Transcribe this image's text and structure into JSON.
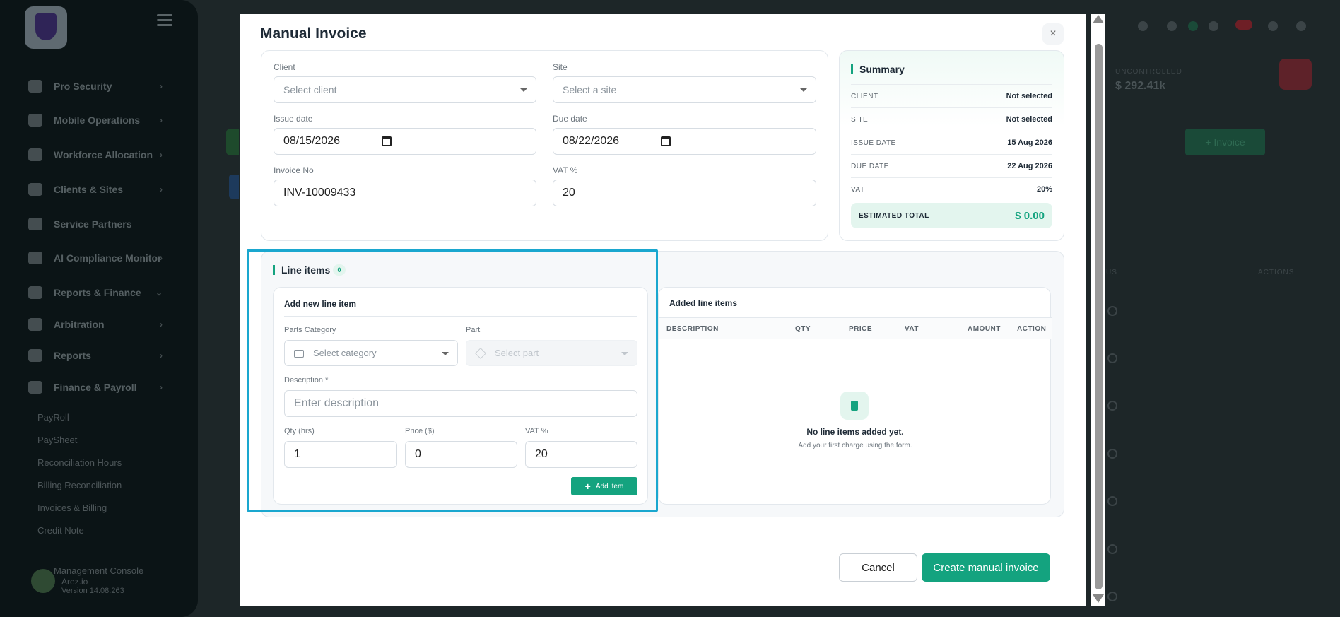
{
  "sidebar": {
    "items": [
      {
        "label": "Pro Security"
      },
      {
        "label": "Mobile Operations"
      },
      {
        "label": "Workforce Allocation"
      },
      {
        "label": "Clients & Sites"
      },
      {
        "label": "Service Partners"
      },
      {
        "label": "AI Compliance Monitor"
      },
      {
        "label": "Reports & Finance"
      },
      {
        "label": "Arbitration"
      },
      {
        "label": "Reports"
      },
      {
        "label": "Finance & Payroll"
      }
    ],
    "sub_items": [
      {
        "label": "PayRoll"
      },
      {
        "label": "PaySheet"
      },
      {
        "label": "Reconciliation Hours"
      },
      {
        "label": "Billing Reconciliation"
      },
      {
        "label": "Invoices & Billing"
      },
      {
        "label": "Credit Note"
      }
    ],
    "console": {
      "title": "Management Console",
      "subtitle": "Arez.io",
      "version": "Version 14.08.263"
    }
  },
  "background": {
    "uncontrolled_label": "UNCONTROLLED",
    "amount": "$ 292.41k",
    "invoice_button": "+ Invoice",
    "col_status": "US",
    "col_actions": "ACTIONS"
  },
  "modal": {
    "title": "Manual Invoice",
    "close": "×",
    "form": {
      "client_label": "Client",
      "client_placeholder": "Select client",
      "site_label": "Site",
      "site_placeholder": "Select a site",
      "issue_date_label": "Issue date",
      "issue_date_value": "08/15/2026",
      "due_date_label": "Due date",
      "due_date_value": "08/22/2026",
      "invoice_no_label": "Invoice No",
      "invoice_no_value": "INV-10009433",
      "vat_label": "VAT %",
      "vat_value": "20"
    },
    "summary": {
      "title": "Summary",
      "rows": [
        {
          "k": "CLIENT",
          "v": "Not selected"
        },
        {
          "k": "SITE",
          "v": "Not selected"
        },
        {
          "k": "ISSUE DATE",
          "v": "15 Aug 2026"
        },
        {
          "k": "DUE DATE",
          "v": "22 Aug 2026"
        },
        {
          "k": "VAT",
          "v": "20%"
        }
      ],
      "estimated_label": "ESTIMATED TOTAL",
      "estimated_value": "$ 0.00"
    },
    "line_items": {
      "title": "Line items",
      "count": "0",
      "add_title": "Add new line item",
      "parts_category_label": "Parts Category",
      "parts_category_placeholder": "Select category",
      "part_label": "Part",
      "part_placeholder": "Select part",
      "description_label": "Description *",
      "description_placeholder": "Enter description",
      "qty_label": "Qty (hrs)",
      "qty_value": "1",
      "price_label": "Price ($)",
      "price_value": "0",
      "vat_label": "VAT %",
      "vat_value": "20",
      "add_button": "Add item",
      "added_title": "Added line items",
      "columns": [
        "DESCRIPTION",
        "QTY",
        "PRICE",
        "VAT",
        "AMOUNT",
        "ACTION"
      ],
      "empty_title": "No line items added yet.",
      "empty_sub": "Add your first charge using the form."
    },
    "cancel_button": "Cancel",
    "create_button": "Create manual invoice"
  }
}
